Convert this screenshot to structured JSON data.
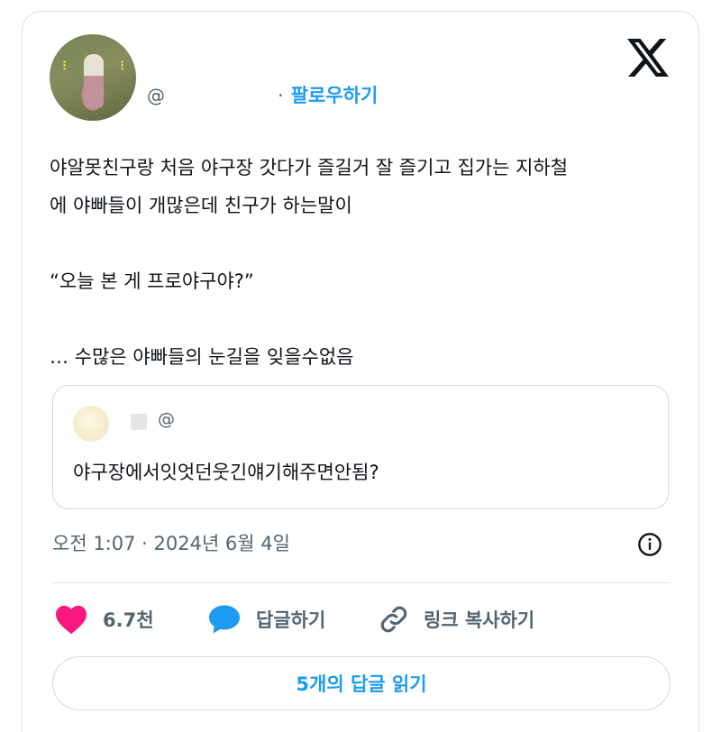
{
  "author": {
    "handle_prefix": "@",
    "follow_separator": "·",
    "follow_label": "팔로우하기"
  },
  "tweet": {
    "text": "야알못친구랑 처음 야구장 갓다가 즐길거 잘 즐기고 집가는 지하철\n에 야빠들이 개많은데 친구가 하는말이\n\n“오늘 본 게 프로야구야?”\n\n… 수많은 야빠들의 눈길을 잊을수없음",
    "timestamp": "오전 1:07 · 2024년 6월 4일"
  },
  "quoted": {
    "handle_prefix": "@",
    "text": "야구장에서잇엇던웃긴얘기해주면안됨?"
  },
  "actions": {
    "like_count": "6.7천",
    "reply_label": "답글하기",
    "copy_link_label": "링크 복사하기",
    "read_replies_label": "5개의 답글 읽기"
  },
  "icons": {
    "brand": "x-logo-icon",
    "like": "heart-icon",
    "reply": "speech-bubble-icon",
    "copy": "link-icon",
    "info": "info-icon"
  },
  "colors": {
    "accent": "#1d9bf0",
    "like": "#f91880",
    "muted": "#536471",
    "text": "#0f1419"
  }
}
